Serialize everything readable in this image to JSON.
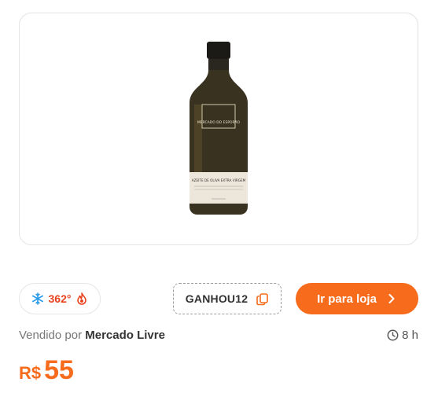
{
  "product": {
    "image_alt": "Olive oil bottle",
    "bottle_label_top": "MERCADO DO ESPORÃO",
    "bottle_label_main": "AZEITE DE OLIVA EXTRA VIRGEM"
  },
  "temperature": {
    "value": "362°",
    "cold_icon": "snowflake-icon",
    "hot_icon": "flame-icon"
  },
  "coupon": {
    "code": "GANHOU12",
    "icon": "copy-icon"
  },
  "go_button": {
    "label": "Ir para loja",
    "icon": "chevron-right-icon"
  },
  "seller": {
    "prefix": "Vendido por",
    "name": "Mercado Livre"
  },
  "posted": {
    "icon": "clock-icon",
    "age": "8 h"
  },
  "price": {
    "currency": "R$",
    "value": "55"
  },
  "colors": {
    "accent": "#f76b1c",
    "hot": "#e8421c",
    "cold": "#2a9be8"
  }
}
